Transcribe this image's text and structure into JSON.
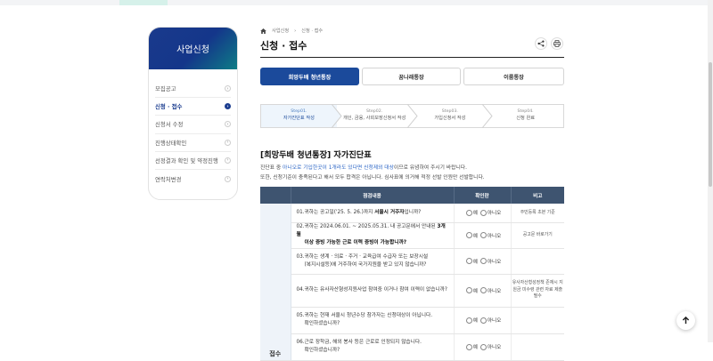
{
  "colors": {
    "brand": "#1b4a9b",
    "header_gradient_start": "#1a3a8c",
    "header_gradient_end": "#0e7d86",
    "table_header": "#3e5470",
    "highlight": "#2a64c5"
  },
  "sidebar": {
    "title": "사업신청",
    "items": [
      {
        "label": "모집공고",
        "active": false
      },
      {
        "label": "신청 · 접수",
        "active": true
      },
      {
        "label": "신청서 수정",
        "active": false
      },
      {
        "label": "진행상태확인",
        "active": false
      },
      {
        "label": "선정결과 확인 및 약정진행",
        "active": false
      },
      {
        "label": "연락처변경",
        "active": false
      }
    ]
  },
  "breadcrumb": {
    "icon": "home-icon",
    "level1": "사업신청",
    "level2": "신청 · 접수"
  },
  "page_title": "신청 · 접수",
  "actions": {
    "share_icon": "share-icon",
    "print_icon": "print-icon"
  },
  "tabs": [
    {
      "label": "희망두배 청년통장",
      "active": true
    },
    {
      "label": "꿈나래통장",
      "active": false
    },
    {
      "label": "이룸통장",
      "active": false
    }
  ],
  "steps": [
    {
      "num": "Step01.",
      "label": "자가진단표 작성",
      "active": true
    },
    {
      "num": "Step02.",
      "label": "개인, 금융, 사회보장신청서 작성",
      "active": false
    },
    {
      "num": "Step03.",
      "label": "가입신청서 작성",
      "active": false
    },
    {
      "num": "Step04.",
      "label": "신청 완료",
      "active": false
    }
  ],
  "section": {
    "title": "[희망두배 청년통장] 자가진단표",
    "desc1_pre": "진단표 중 ",
    "desc1_hl": "아니오로 기입한곳이 1개라도 있다면 신청제외 대상",
    "desc1_post": "이므로 유념하여 주시기 바랍니다.",
    "desc2": "또한, 신청기준이 충족된다고 해서 모두 합격은 아닙니다. 심사표에 의거해 적정 선발 인원만 선발합니다."
  },
  "table": {
    "headers": [
      "",
      "점검내용",
      "확인란",
      "비고"
    ],
    "group_label": "접수",
    "yes_label": "예",
    "no_label": "아니오",
    "rows": [
      {
        "num": "01.",
        "pre": "귀하는 공고일('25. 5. 26.)까지 ",
        "bold": "서울시 거주자",
        "post": "입니까?",
        "line2": "",
        "note": "주민등록 초본 기준"
      },
      {
        "num": "02.",
        "pre": "귀하는 2024.06.01. ~ 2025.05.31. 내 공고문에서 안내된 ",
        "bold": "3개월",
        "post": "",
        "line2": "이상 증빙 가능한 근로 이력 증빙이 가능합니까?",
        "note": "공고문 바로가기"
      },
      {
        "num": "03.",
        "pre": "귀하는 생계 · 의료 · 주거 · 교육급여 수급자 또는 보장시설",
        "bold": "",
        "post": "",
        "line2": "(복지시설등)에 거주하여 국가지원을 받고 있지 않습니까?",
        "note": ""
      },
      {
        "num": "04.",
        "pre": "귀하는 유사자산형성지원사업 참여중 이거나 참여 이력이 없습니까?",
        "bold": "",
        "post": "",
        "line2": "",
        "note": "유사자산형성정책 존재시 지원금 미수령 관련 자료 제출 필수"
      },
      {
        "num": "05.",
        "pre": "귀하는 현재 서울시 청년수당 참가자는 신청대상이 아닙니다.",
        "bold": "",
        "post": "",
        "line2": "확인하셨습니까?",
        "note": ""
      },
      {
        "num": "06.",
        "pre": "근로 장학금, 해외 봉사 등은 근로로 인정되지 않습니다.",
        "bold": "",
        "post": "",
        "line2": "확인하셨습니까?",
        "note": ""
      }
    ]
  },
  "scroll_top_icon": "arrow-up-icon"
}
